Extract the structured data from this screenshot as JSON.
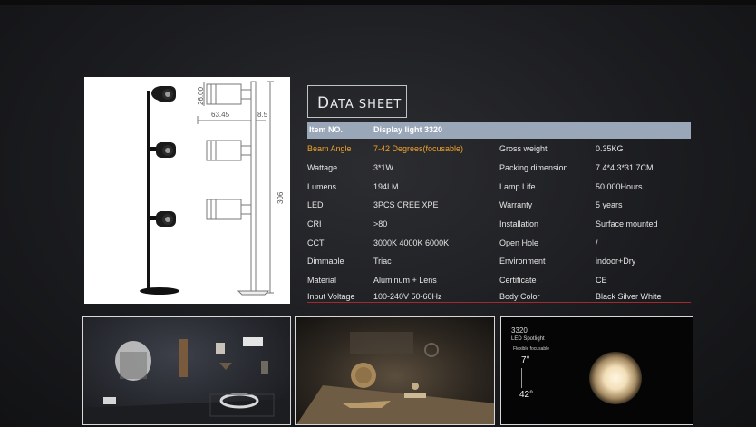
{
  "datasheet": {
    "title_first": "D",
    "title_rest": "ATA SHEET",
    "header": {
      "label": "Item NO.",
      "value": "Display light 3320"
    },
    "rows": [
      {
        "l1": "Beam Angle",
        "v1": "7-42 Degrees(focusable)",
        "l2": "Gross weight",
        "v2": "0.35KG"
      },
      {
        "l1": "Wattage",
        "v1": "3*1W",
        "l2": "Packing dimension",
        "v2": "7.4*4.3*31.7CM"
      },
      {
        "l1": "Lumens",
        "v1": "194LM",
        "l2": "Lamp Life",
        "v2": "50,000Hours"
      },
      {
        "l1": "LED",
        "v1": "3PCS CREE XPE",
        "l2": "Warranty",
        "v2": "5 years"
      },
      {
        "l1": "CRI",
        "v1": ">80",
        "l2": "Installation",
        "v2": "Surface mounted"
      },
      {
        "l1": "CCT",
        "v1": "3000K 4000K 6000K",
        "l2": "Open Hole",
        "v2": "/"
      },
      {
        "l1": "Dimmable",
        "v1": "Triac",
        "l2": "Environment",
        "v2": "indoor+Dry"
      },
      {
        "l1": "Material",
        "v1": "Aluminum + Lens",
        "l2": "Certificate",
        "v2": "CE"
      },
      {
        "l1": "Input Voltage",
        "v1": "100-240V 50-60Hz",
        "l2": "Body Color",
        "v2": "Black Silver White"
      }
    ]
  },
  "diagram": {
    "dim_top": "26.00",
    "dim_width": "63.45",
    "dim_side": "8.5",
    "dim_height": "306"
  },
  "spotlight_photo": {
    "model": "3320",
    "product": "LED Spotlight",
    "feature": "Flexible focusable",
    "angle_min": "7°",
    "angle_max": "42°"
  },
  "colors": {
    "highlight": "#f0a22d",
    "header_bar": "#9aa7b9",
    "rule": "#a3282f"
  }
}
